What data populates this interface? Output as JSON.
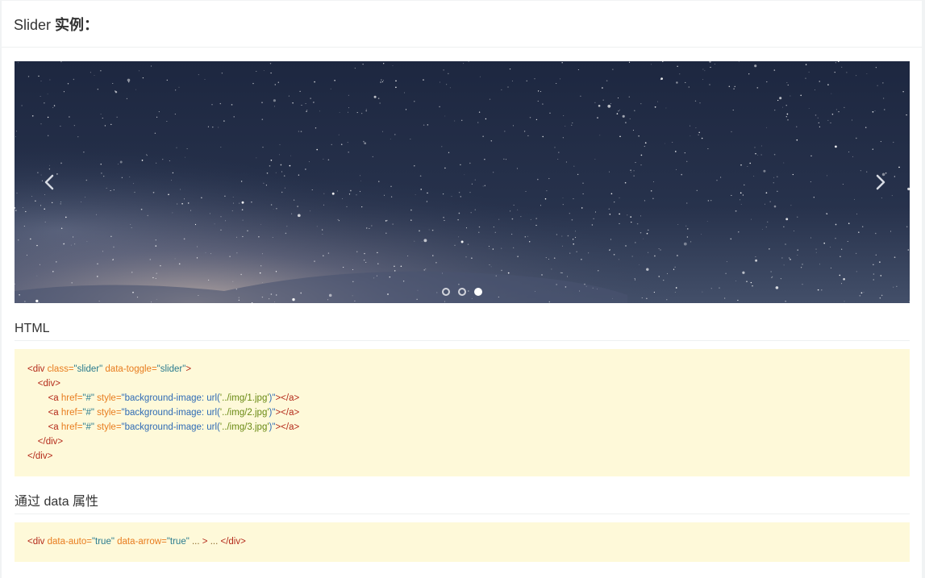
{
  "header": {
    "title_prefix": "Slider",
    "title_suffix": "实例："
  },
  "slider": {
    "prev_icon": "chevron-left-icon",
    "next_icon": "chevron-right-icon",
    "dots": [
      {
        "active": false
      },
      {
        "active": false
      },
      {
        "active": true
      }
    ],
    "colors": {
      "sky_top": "#1f2a40",
      "sky_bottom": "#3a4660",
      "haze": "#b9a9a8"
    }
  },
  "html_section": {
    "title": "HTML",
    "lines": [
      [
        {
          "t": "tag",
          "v": "<div "
        },
        {
          "t": "attr",
          "v": "class="
        },
        {
          "t": "val",
          "v": "\"slider\""
        },
        {
          "t": "attr",
          "v": " data-toggle="
        },
        {
          "t": "val",
          "v": "\"slider\""
        },
        {
          "t": "tag",
          "v": ">"
        }
      ],
      [
        {
          "t": "plain",
          "v": "    "
        },
        {
          "t": "tag",
          "v": "<div>"
        }
      ],
      [
        {
          "t": "plain",
          "v": "        "
        },
        {
          "t": "tag",
          "v": "<a "
        },
        {
          "t": "attr",
          "v": "href="
        },
        {
          "t": "val",
          "v": "\"#\""
        },
        {
          "t": "attr",
          "v": " style="
        },
        {
          "t": "val2",
          "v": "\"background-image: "
        },
        {
          "t": "val2",
          "v": "url("
        },
        {
          "t": "url",
          "v": "'../img/1.jpg'"
        },
        {
          "t": "val2",
          "v": ")\""
        },
        {
          "t": "tag",
          "v": "></a>"
        }
      ],
      [
        {
          "t": "plain",
          "v": "        "
        },
        {
          "t": "tag",
          "v": "<a "
        },
        {
          "t": "attr",
          "v": "href="
        },
        {
          "t": "val",
          "v": "\"#\""
        },
        {
          "t": "attr",
          "v": " style="
        },
        {
          "t": "val2",
          "v": "\"background-image: "
        },
        {
          "t": "val2",
          "v": "url("
        },
        {
          "t": "url",
          "v": "'../img/2.jpg'"
        },
        {
          "t": "val2",
          "v": ")\""
        },
        {
          "t": "tag",
          "v": "></a>"
        }
      ],
      [
        {
          "t": "plain",
          "v": "        "
        },
        {
          "t": "tag",
          "v": "<a "
        },
        {
          "t": "attr",
          "v": "href="
        },
        {
          "t": "val",
          "v": "\"#\""
        },
        {
          "t": "attr",
          "v": " style="
        },
        {
          "t": "val2",
          "v": "\"background-image: "
        },
        {
          "t": "val2",
          "v": "url("
        },
        {
          "t": "url",
          "v": "'../img/3.jpg'"
        },
        {
          "t": "val2",
          "v": ")\""
        },
        {
          "t": "tag",
          "v": "></a>"
        }
      ],
      [
        {
          "t": "plain",
          "v": "    "
        },
        {
          "t": "tag",
          "v": "</div>"
        }
      ],
      [
        {
          "t": "tag",
          "v": "</div>"
        }
      ]
    ]
  },
  "data_section": {
    "title": "通过 data 属性",
    "lines": [
      [
        {
          "t": "tag",
          "v": "<div "
        },
        {
          "t": "attr",
          "v": "data-auto="
        },
        {
          "t": "val",
          "v": "\"true\""
        },
        {
          "t": "attr",
          "v": " data-arrow="
        },
        {
          "t": "val",
          "v": "\"true\""
        },
        {
          "t": "plain",
          "v": " ... "
        },
        {
          "t": "tag",
          "v": "> "
        },
        {
          "t": "plain",
          "v": "... "
        },
        {
          "t": "tag",
          "v": "</div>"
        }
      ]
    ]
  }
}
